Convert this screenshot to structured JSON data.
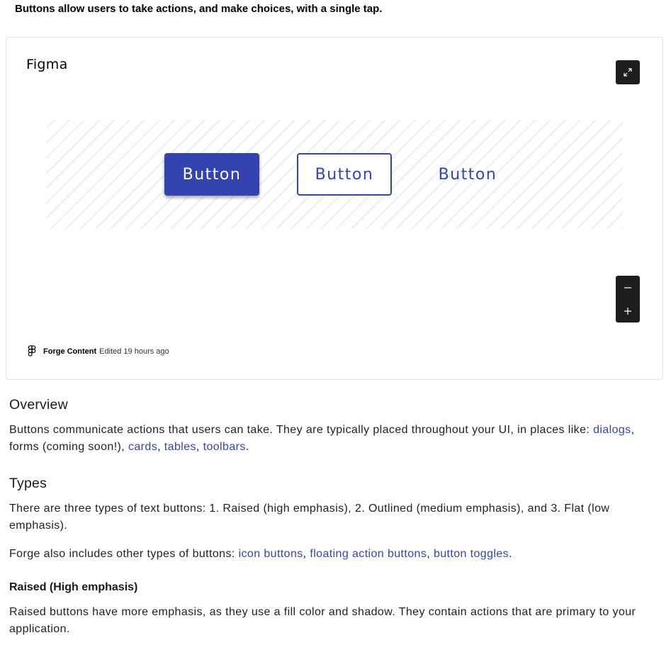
{
  "intro_text": "Buttons allow users to take actions, and make choices, with a single tap.",
  "figma_embed": {
    "title": "Figma",
    "expand_icon": "expand-icon",
    "demo_buttons": {
      "raised_label": "Button",
      "outlined_label": "Button",
      "flat_label": "Button"
    },
    "zoom_out_icon": "minus-icon",
    "zoom_in_icon": "plus-icon",
    "footer": {
      "author": "Forge Content",
      "edited": "Edited 19 hours ago"
    }
  },
  "overview": {
    "heading": "Overview",
    "text_before": "Buttons communicate actions that users can take. They are typically placed throughout your UI, in places like: ",
    "link_dialogs": "dialogs",
    "sep_forms": ", forms (coming soon!), ",
    "link_cards": "cards",
    "comma_1": ", ",
    "link_tables": "tables",
    "comma_2": ", ",
    "link_toolbars": "toolbars",
    "period": "."
  },
  "types": {
    "heading": "Types",
    "paragraph_1": "There are three types of text buttons: 1. Raised (high emphasis), 2. Outlined (medium emphasis), and 3. Flat (low emphasis).",
    "p2_before": "Forge also includes other types of buttons: ",
    "link_icon_buttons": "icon buttons",
    "comma_1": ", ",
    "link_fab": "floating action buttons",
    "comma_2": ", ",
    "link_toggles": "button toggles",
    "period": "."
  },
  "raised": {
    "heading": "Raised (High emphasis)",
    "text": "Raised buttons have more emphasis, as they use a fill color and shadow. They contain actions that are primary to your application."
  },
  "colors": {
    "accent": "#3346b0",
    "raised_fill": "#3344b0",
    "toolbar_dark": "#1e1e1e"
  }
}
